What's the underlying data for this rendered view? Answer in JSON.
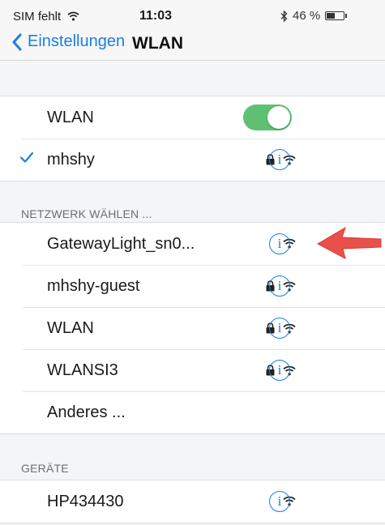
{
  "status": {
    "carrier": "SIM fehlt",
    "time": "11:03",
    "battery": "46 %",
    "battery_level": 0.46,
    "icons": [
      "wifi-icon",
      "bluetooth-icon",
      "battery-icon"
    ]
  },
  "nav": {
    "back_label": "Einstellungen",
    "title": "WLAN"
  },
  "wlan": {
    "label": "WLAN",
    "enabled": true,
    "connected_network": "mhshy"
  },
  "choose_header": "NETZWERK WÄHLEN ...",
  "networks": [
    {
      "name": "GatewayLight_sn0...",
      "locked": false
    },
    {
      "name": "mhshy-guest",
      "locked": true
    },
    {
      "name": "WLAN",
      "locked": true
    },
    {
      "name": "WLANSI3",
      "locked": true
    }
  ],
  "other_label": "Anderes ...",
  "devices_header": "GERÄTE",
  "devices": [
    {
      "name": "HP434430",
      "locked": false
    }
  ],
  "info_glyph": "i",
  "colors": {
    "accent": "#1a7fe0",
    "toggle_on": "#5fbf73",
    "annotation_arrow": "#e8504a"
  }
}
